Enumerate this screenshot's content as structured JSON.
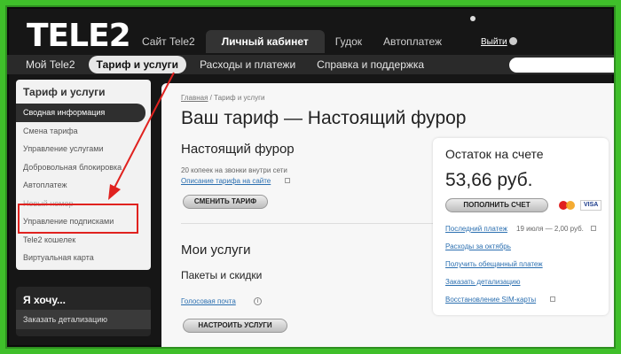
{
  "header": {
    "logo": "TELE2",
    "top_nav": [
      {
        "label": "Сайт Tele2",
        "active": false
      },
      {
        "label": "Личный кабинет",
        "active": true
      },
      {
        "label": "Гудок",
        "active": false
      },
      {
        "label": "Автоплатеж",
        "active": false
      }
    ],
    "logout_label": "Выйти",
    "sub_nav": [
      {
        "label": "Мой Tele2",
        "active": false
      },
      {
        "label": "Тариф и услуги",
        "active": true
      },
      {
        "label": "Расходы и платежи",
        "active": false
      },
      {
        "label": "Справка и поддержка",
        "active": false
      }
    ],
    "search": {
      "placeholder": "",
      "value": ""
    }
  },
  "sidebar": {
    "title": "Тариф и услуги",
    "items": [
      {
        "label": "Сводная информация",
        "active": true
      },
      {
        "label": "Смена тарифа"
      },
      {
        "label": "Управление услугами"
      },
      {
        "label": "Добровольная блокировка"
      },
      {
        "label": "Автоплатеж"
      },
      {
        "label": "Новый номер"
      },
      {
        "label": "Управление подписками"
      },
      {
        "label": "Tele2 кошелек"
      },
      {
        "label": "Виртуальная карта"
      }
    ]
  },
  "want": {
    "title": "Я хочу...",
    "item": "Заказать детализацию"
  },
  "main": {
    "breadcrumb": {
      "link": "Главная",
      "sep": " / ",
      "current": "Тариф и услуги"
    },
    "page_title": "Ваш тариф — Настоящий фурор",
    "tariff": {
      "name": "Настоящий фурор",
      "desc": "20 копеек на звонки внутри сети",
      "desc_link": "Описание тарифа на сайте",
      "change_button": "СМЕНИТЬ ТАРИФ"
    },
    "services": {
      "title": "Мои услуги",
      "packages_title": "Пакеты и скидки",
      "voicemail": "Голосовая почта",
      "info_icon_glyph": "i",
      "configure_button": "НАСТРОИТЬ УСЛУГИ"
    },
    "balance": {
      "title": "Остаток на счете",
      "amount": "53,66 руб.",
      "topup_button": "ПОПОЛНИТЬ СЧЕТ",
      "visa_label": "VISA",
      "last_payment_link": "Последний платеж",
      "last_payment_detail": "19 июля — 2,00 руб.",
      "links": [
        "Расходы за октябрь",
        "Получить обещанный платеж",
        "Заказать детализацию",
        "Восстановление SIM-карты"
      ]
    }
  },
  "colors": {
    "frame_green": "#3fbf2a",
    "annotation_red": "#e0221f",
    "link_blue": "#2b6fb0"
  }
}
